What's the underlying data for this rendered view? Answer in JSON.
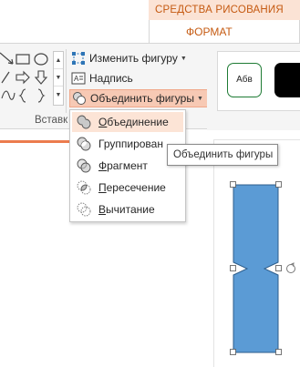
{
  "contextual_tab": {
    "group_title": "СРЕДСТВА РИСОВАНИЯ",
    "tab_label": "ФОРМАТ"
  },
  "ribbon": {
    "commands": {
      "edit_shape": "Изменить фигуру",
      "text_box": "Надпись",
      "merge_shapes": "Объединить фигуры"
    },
    "group_label": "Вставк",
    "shape_style_sample": "Абв"
  },
  "merge_menu": {
    "items": [
      {
        "label": "Объединение",
        "underline_char": "О",
        "rest": "бъединение",
        "icon": "union-icon",
        "hover": true
      },
      {
        "label": "Группирован",
        "underline_char": "",
        "rest": "Группирован",
        "icon": "combine-icon",
        "hover": false
      },
      {
        "label": "Фрагмент",
        "underline_char": "Ф",
        "rest": "рагмент",
        "icon": "fragment-icon",
        "hover": false
      },
      {
        "label": "Пересечение",
        "underline_char": "П",
        "rest": "ересечение",
        "icon": "intersect-icon",
        "hover": false
      },
      {
        "label": "Вычитание",
        "underline_char": "В",
        "rest": "ычитание",
        "icon": "subtract-icon",
        "hover": false
      }
    ]
  },
  "tooltip": {
    "text": "Объединить фигуры"
  },
  "colors": {
    "accent_orange": "#c55a11",
    "tab_bg": "#fbe3d5",
    "menu_hover": "#fce4d6",
    "active_button": "#f7c9b4",
    "shape_fill": "#5b9bd5",
    "shape_stroke": "#2e5e8c"
  }
}
